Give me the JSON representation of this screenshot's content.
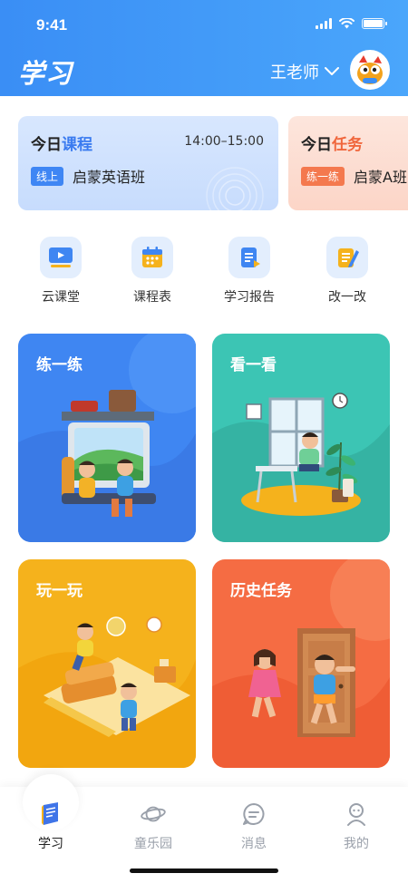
{
  "status": {
    "time": "9:41"
  },
  "header": {
    "title": "学习",
    "teacher": "王老师"
  },
  "courses": [
    {
      "title_prefix": "今日",
      "title_accent": "课程",
      "time": "14:00–15:00",
      "tag": "线上",
      "name": "启蒙英语班"
    },
    {
      "title_prefix": "今日",
      "title_accent": "任务",
      "tag": "练一练",
      "name": "启蒙A班"
    }
  ],
  "quick_actions": [
    {
      "label": "云课堂",
      "icon": "cloud-classroom-icon"
    },
    {
      "label": "课程表",
      "icon": "calendar-icon"
    },
    {
      "label": "学习报告",
      "icon": "report-icon"
    },
    {
      "label": "改一改",
      "icon": "edit-notes-icon"
    }
  ],
  "cards": [
    {
      "title": "练一练"
    },
    {
      "title": "看一看"
    },
    {
      "title": "玩一玩"
    },
    {
      "title": "历史任务"
    }
  ],
  "tabbar": [
    {
      "label": "学习",
      "icon": "study-icon",
      "active": true
    },
    {
      "label": "童乐园",
      "icon": "planet-icon"
    },
    {
      "label": "消息",
      "icon": "message-icon"
    },
    {
      "label": "我的",
      "icon": "profile-icon"
    }
  ],
  "colors": {
    "header": "#3a8ef5",
    "card1": "#3f86f2",
    "card2": "#3cc5b4",
    "card3": "#f5b21c",
    "card4": "#f56c43"
  }
}
